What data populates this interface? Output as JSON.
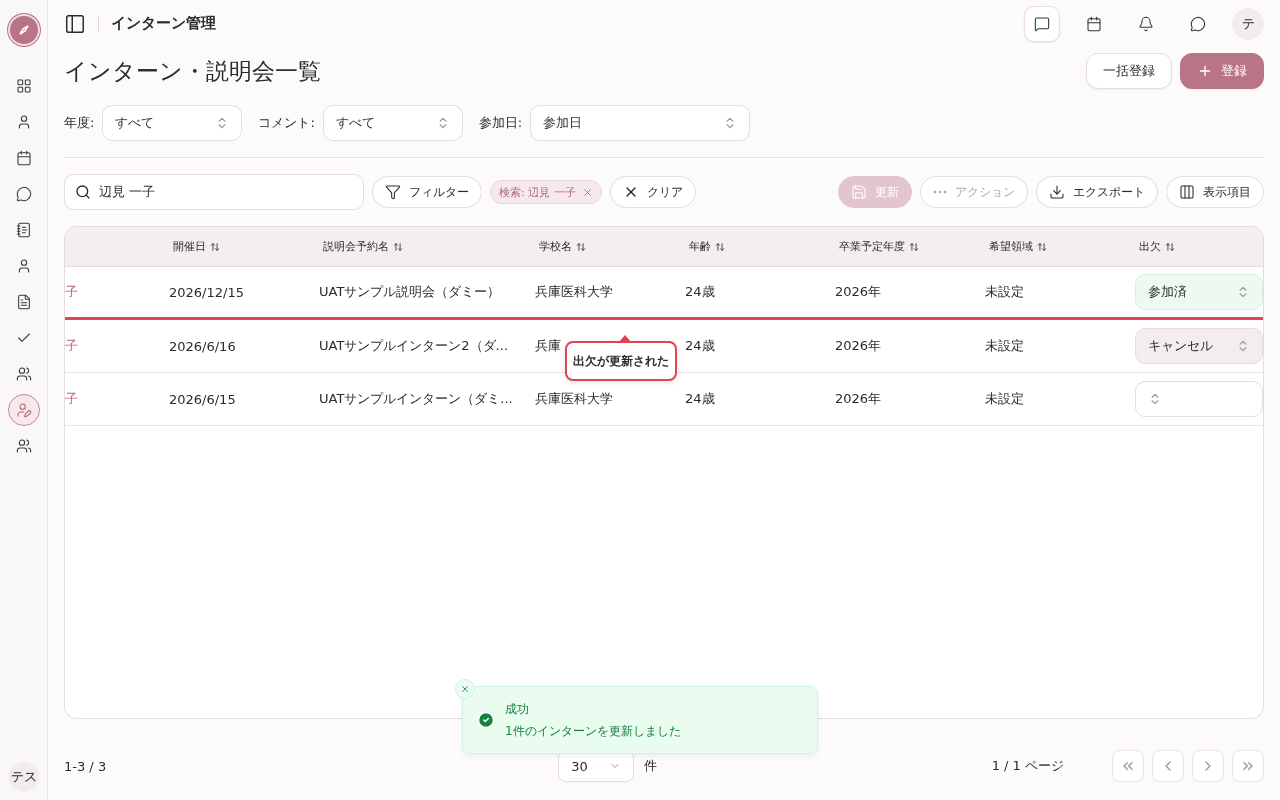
{
  "sidebar": {
    "avatar": "テス",
    "items": [
      {
        "selected": false
      },
      {
        "selected": false
      },
      {
        "selected": false
      },
      {
        "selected": false
      },
      {
        "selected": false
      },
      {
        "selected": false
      },
      {
        "selected": false
      },
      {
        "selected": false
      },
      {
        "selected": false
      },
      {
        "selected": true
      },
      {
        "selected": false
      }
    ]
  },
  "header": {
    "title": "インターン管理",
    "avatar": "テ",
    "icons": [
      {
        "selected": true
      },
      {
        "selected": false
      },
      {
        "selected": false
      },
      {
        "selected": false
      }
    ]
  },
  "page": {
    "title": "インターン・説明会一覧",
    "buttons": [
      {
        "label": "一括登録",
        "kind": "outline"
      },
      {
        "label": "登録",
        "kind": "primary"
      }
    ]
  },
  "filters": [
    {
      "label": "年度:",
      "value": "すべて"
    },
    {
      "label": "コメント:",
      "value": "すべて"
    },
    {
      "label": "参加日:",
      "value": "参加日"
    }
  ],
  "toolbar": {
    "search": "辺見 一子",
    "filter_button": "フィルター",
    "chip": "検索: 辺見 一子",
    "clear_button": "クリア",
    "actions": [
      {
        "label": "更新",
        "disabled": true,
        "kind": "primary"
      },
      {
        "label": "アクション",
        "disabled": true,
        "kind": "outline"
      },
      {
        "label": "エクスポート",
        "disabled": false,
        "kind": "outline"
      },
      {
        "label": "表示項目",
        "disabled": false,
        "kind": "outline"
      }
    ]
  },
  "table": {
    "columns": [
      "",
      "開催日",
      "説明会予約名",
      "学校名",
      "年齢",
      "卒業予定年度",
      "希望領域",
      "出欠"
    ],
    "rows": [
      {
        "cells": [
          "子",
          "2026/12/15",
          "UATサンプル説明会（ダミー）",
          "兵庫医科大学",
          "24歳",
          "2026年",
          "未設定"
        ],
        "attendance": {
          "value": "参加済",
          "kind": "attended"
        },
        "highlighted": true
      },
      {
        "cells": [
          "子",
          "2026/6/16",
          "UATサンプルインターン2（ダ...",
          "兵庫",
          "24歳",
          "2026年",
          "未設定"
        ],
        "attendance": {
          "value": "キャンセル",
          "kind": "cancelled"
        },
        "highlighted": false
      },
      {
        "cells": [
          "子",
          "2026/6/15",
          "UATサンプルインターン（ダミ...",
          "兵庫医科大学",
          "24歳",
          "2026年",
          "未設定"
        ],
        "attendance": {
          "kind": "none"
        },
        "highlighted": false
      }
    ]
  },
  "tooltip": "出欠が更新された",
  "footer": {
    "count": "1-3 / 3",
    "page_size": "30",
    "page_size_unit": "件",
    "pages": "1 / 1 ページ"
  },
  "toast": {
    "title": "成功",
    "message": "1件のインターンを更新しました"
  }
}
